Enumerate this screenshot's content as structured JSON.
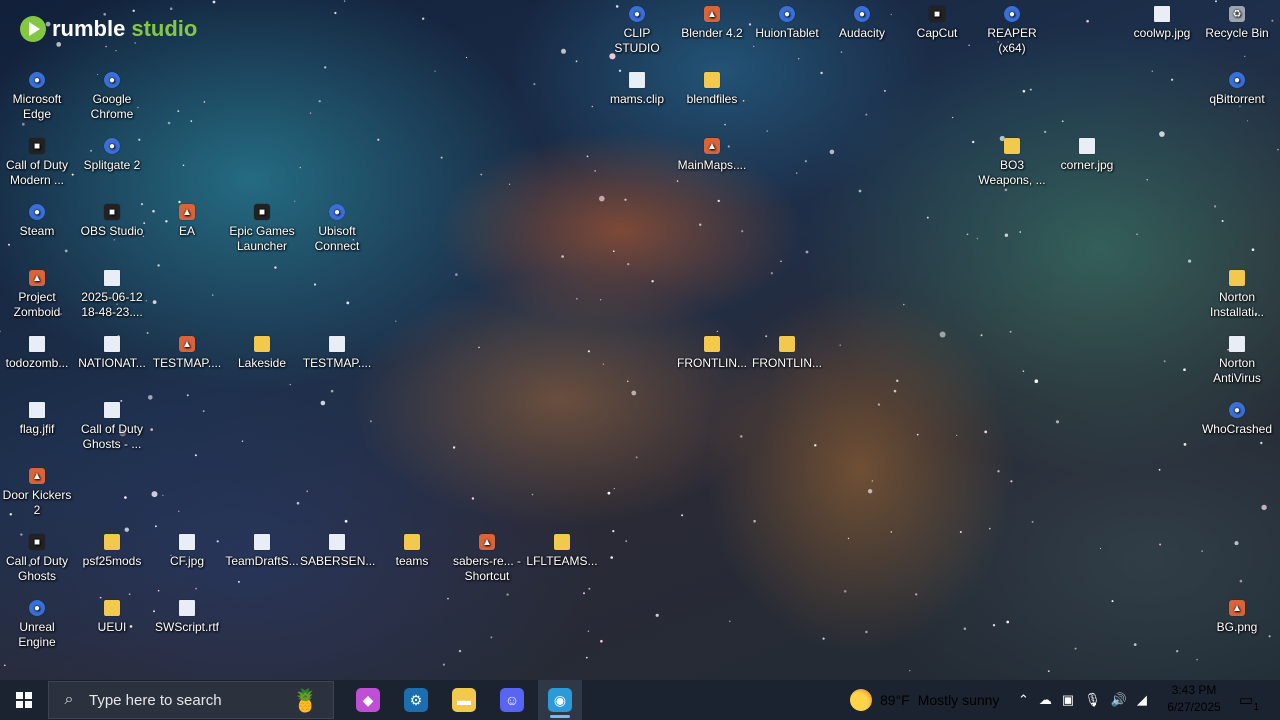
{
  "overlay_logo": {
    "rumble": "rumble",
    "studio": "studio"
  },
  "desktop_icons": [
    {
      "label": "Microsoft Edge",
      "type": "app",
      "icon": "edge-icon"
    },
    {
      "label": "Google Chrome",
      "type": "app",
      "icon": "chrome-icon"
    },
    {
      "label": "Call of Duty Modern ...",
      "type": "game",
      "icon": "game-icon"
    },
    {
      "label": "Splitgate 2",
      "type": "app",
      "icon": "game-icon"
    },
    {
      "label": "Steam",
      "type": "app",
      "icon": "steam-icon"
    },
    {
      "label": "OBS Studio",
      "type": "game",
      "icon": "obs-icon"
    },
    {
      "label": "EA",
      "type": "image",
      "icon": "ea-icon"
    },
    {
      "label": "Epic Games Launcher",
      "type": "game",
      "icon": "epic-icon"
    },
    {
      "label": "Ubisoft Connect",
      "type": "app",
      "icon": "ubisoft-icon"
    },
    {
      "label": "Project Zomboid",
      "type": "image",
      "icon": "game-icon"
    },
    {
      "label": "2025-06-12 18-48-23....",
      "type": "file",
      "icon": "video-file-icon"
    },
    {
      "label": "todozomb...",
      "type": "file",
      "icon": "file-icon"
    },
    {
      "label": "NATIONAT...",
      "type": "file",
      "icon": "file-icon"
    },
    {
      "label": "TESTMAP....",
      "type": "image",
      "icon": "image-file-icon"
    },
    {
      "label": "Lakeside",
      "type": "folder",
      "icon": "folder-icon"
    },
    {
      "label": "TESTMAP....",
      "type": "file",
      "icon": "file-icon"
    },
    {
      "label": "flag.jfif",
      "type": "file",
      "icon": "image-file-icon"
    },
    {
      "label": "Call of Duty Ghosts - ...",
      "type": "file",
      "icon": "game-icon"
    },
    {
      "label": "Door Kickers 2",
      "type": "image",
      "icon": "game-icon"
    },
    {
      "label": "Call of Duty Ghosts",
      "type": "game",
      "icon": "game-icon"
    },
    {
      "label": "psf25mods",
      "type": "folder",
      "icon": "folder-icon"
    },
    {
      "label": "CF.jpg",
      "type": "file",
      "icon": "image-file-icon"
    },
    {
      "label": "TeamDraftS...",
      "type": "file",
      "icon": "file-icon"
    },
    {
      "label": "SABERSEN...",
      "type": "file",
      "icon": "file-icon"
    },
    {
      "label": "teams",
      "type": "folder",
      "icon": "folder-icon"
    },
    {
      "label": "sabers-re... - Shortcut",
      "type": "image",
      "icon": "shortcut-icon"
    },
    {
      "label": "LFLTEAMS...",
      "type": "folder",
      "icon": "folder-icon"
    },
    {
      "label": "Unreal Engine",
      "type": "app",
      "icon": "unreal-icon"
    },
    {
      "label": "UEUI",
      "type": "folder",
      "icon": "folder-icon"
    },
    {
      "label": "SWScript.rtf",
      "type": "file",
      "icon": "file-icon"
    },
    {
      "label": "CLIP STUDIO",
      "type": "app",
      "icon": "clip-studio-icon"
    },
    {
      "label": "Blender 4.2",
      "type": "image",
      "icon": "blender-icon"
    },
    {
      "label": "HuionTablet",
      "type": "app",
      "icon": "huion-icon"
    },
    {
      "label": "Audacity",
      "type": "app",
      "icon": "audacity-icon"
    },
    {
      "label": "CapCut",
      "type": "game",
      "icon": "capcut-icon"
    },
    {
      "label": "REAPER (x64)",
      "type": "app",
      "icon": "reaper-icon"
    },
    {
      "label": "mams.clip",
      "type": "file",
      "icon": "clip-file-icon"
    },
    {
      "label": "blendfiles",
      "type": "folder",
      "icon": "folder-icon"
    },
    {
      "label": "MainMaps....",
      "type": "image",
      "icon": "image-file-icon"
    },
    {
      "label": "FRONTLIN...",
      "type": "folder",
      "icon": "folder-icon"
    },
    {
      "label": "FRONTLIN...",
      "type": "folder",
      "icon": "folder-icon"
    },
    {
      "label": "BO3 Weapons, ...",
      "type": "folder",
      "icon": "folder-icon"
    },
    {
      "label": "corner.jpg",
      "type": "file",
      "icon": "image-file-icon"
    },
    {
      "label": "coolwp.jpg",
      "type": "file",
      "icon": "image-file-icon"
    },
    {
      "label": "Recycle Bin",
      "type": "bin",
      "icon": "recycle-bin-icon"
    },
    {
      "label": "qBittorrent",
      "type": "app",
      "icon": "qbittorrent-icon"
    },
    {
      "label": "Norton Installati...",
      "type": "folder",
      "icon": "norton-icon"
    },
    {
      "label": "Norton AntiVirus",
      "type": "file",
      "icon": "norton-icon"
    },
    {
      "label": "WhoCrashed",
      "type": "app",
      "icon": "whocrashed-icon"
    },
    {
      "label": "BG.png",
      "type": "image",
      "icon": "image-file-icon"
    }
  ],
  "taskbar": {
    "search_placeholder": "Type here to search",
    "apps": [
      {
        "name": "copilot-taskbar-icon",
        "glyph": "◆",
        "color": "#c04fd6",
        "active": false
      },
      {
        "name": "steam-taskbar-icon",
        "glyph": "⚙",
        "color": "#1b6fb0",
        "active": false
      },
      {
        "name": "file-explorer-taskbar-icon",
        "glyph": "▬",
        "color": "#f2c94c",
        "active": false
      },
      {
        "name": "discord-taskbar-icon",
        "glyph": "☺",
        "color": "#5865f2",
        "active": false
      },
      {
        "name": "edge-taskbar-icon",
        "glyph": "◉",
        "color": "#2a9bd8",
        "active": true
      }
    ],
    "weather": {
      "temp": "89°F",
      "condition": "Mostly sunny"
    },
    "clock": {
      "time": "3:43 PM",
      "date": "6/27/2025"
    },
    "notification_count": "1"
  }
}
